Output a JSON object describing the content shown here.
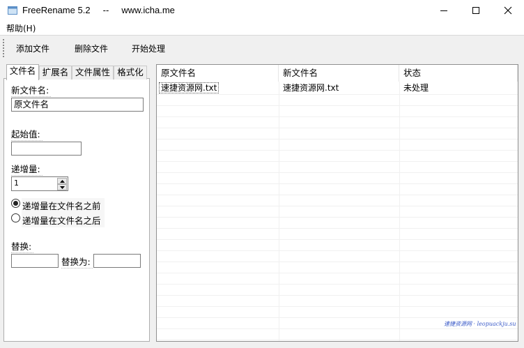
{
  "window": {
    "title": "FreeRename 5.2     --     www.icha.me",
    "controls": {
      "minimize": "minimize",
      "maximize": "maximize",
      "close": "close"
    }
  },
  "menu": {
    "help": "帮助(H)"
  },
  "toolbar": {
    "add_files": "添加文件",
    "remove_files": "删除文件",
    "start_process": "开始处理"
  },
  "tabs": [
    "文件名",
    "扩展名",
    "文件属性",
    "格式化"
  ],
  "form": {
    "new_filename_label": "新文件名:",
    "new_filename_value": "原文件名",
    "start_value_label": "起始值:",
    "start_value": "",
    "increment_label": "递增量:",
    "increment_value": "1",
    "radio_before": "递增量在文件名之前",
    "radio_after": "递增量在文件名之后",
    "replace_label": "替换:",
    "replace_with_label": "替换为:",
    "replace_value": "",
    "replace_with_value": ""
  },
  "table": {
    "columns": [
      "原文件名",
      "新文件名",
      "状态"
    ],
    "rows": [
      [
        "速捷资源网.txt",
        "速捷资源网.txt",
        "未处理"
      ]
    ]
  },
  "watermark": "速捷资源网 · leopuackju.su"
}
